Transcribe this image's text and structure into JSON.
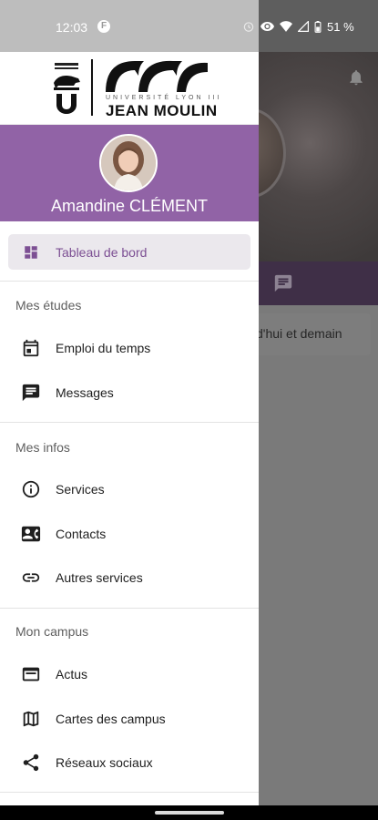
{
  "status_bar": {
    "time": "12:03",
    "notification_badge": "F",
    "battery": "51 %"
  },
  "background_app": {
    "card_text": "d'hui et demain"
  },
  "logo": {
    "small_text": "UNIVERSITÉ LYON III",
    "name": "JEAN MOULIN"
  },
  "profile": {
    "name": "Amandine CLÉMENT"
  },
  "drawer": {
    "dashboard": {
      "label": "Tableau de bord",
      "icon": "dashboard-icon"
    },
    "sections": [
      {
        "title": "Mes études",
        "items": [
          {
            "label": "Emploi du temps",
            "icon": "calendar-icon"
          },
          {
            "label": "Messages",
            "icon": "message-icon"
          }
        ]
      },
      {
        "title": "Mes infos",
        "items": [
          {
            "label": "Services",
            "icon": "info-icon"
          },
          {
            "label": "Contacts",
            "icon": "contact-card-icon"
          },
          {
            "label": "Autres services",
            "icon": "link-icon"
          }
        ]
      },
      {
        "title": "Mon campus",
        "items": [
          {
            "label": "Actus",
            "icon": "news-icon"
          },
          {
            "label": "Cartes des campus",
            "icon": "map-icon"
          },
          {
            "label": "Réseaux sociaux",
            "icon": "share-icon"
          }
        ]
      }
    ]
  },
  "colors": {
    "brand_purple": "#9163a6",
    "accent_text": "#7c4f93",
    "selected_bg": "#ebe8ed"
  }
}
